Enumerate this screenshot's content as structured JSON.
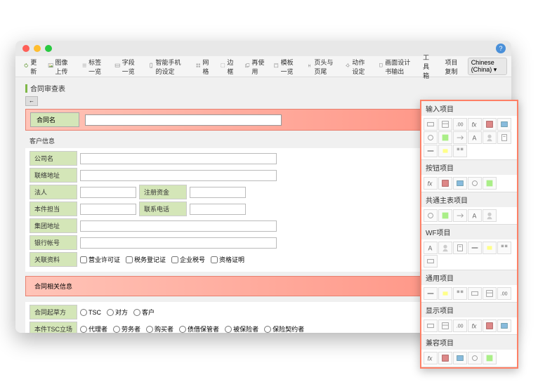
{
  "toolbar": {
    "refresh": "更新",
    "imageUpload": "图像上传",
    "labelList": "标签一览",
    "fieldList": "字段一览",
    "smartphoneSettings": "智能手机的设定",
    "grid": "网格",
    "border": "边框",
    "reuse": "再使用",
    "templateList": "模板一览",
    "headerFooter": "页头与页尾",
    "actionSettings": "动作设定",
    "designOutput": "画面设计书输出",
    "toolbox": "工具箱",
    "itemCopy": "项目复制",
    "language": "Chinese (China)"
  },
  "page": {
    "title": "合同审查表",
    "back": "←"
  },
  "highlight1": {
    "label": "合同名",
    "arrow": "◀◀"
  },
  "customerSection": "客户信息",
  "form": {
    "companyName": "公司名",
    "contactAddress": "联络地址",
    "legalPerson": "法人",
    "registeredCapital": "注册资金",
    "caseOwner": "本件担当",
    "contactPhone": "联系电话",
    "groupAddress": "集团地址",
    "bankAccount": "银行帐号",
    "relatedDocs": "关联资料",
    "relatedDocsOptions": [
      "营业许可证",
      "税务登记证",
      "企业税号",
      "资格证明"
    ]
  },
  "highlight2": {
    "label": "合同相关信息",
    "arrow": "◀◀"
  },
  "form2": {
    "draftParty": "合同起草方",
    "draftOptions": [
      "TSC",
      "对方",
      "客户"
    ],
    "tscPosition": "本件TSC立场",
    "positionOptions": [
      "代理者",
      "劳务者",
      "购买者",
      "债借保管者",
      "被保险者",
      "保险契约者"
    ]
  },
  "palette": {
    "sections": [
      {
        "title": "输入项目",
        "count": 15
      },
      {
        "title": "按钮项目",
        "count": 5
      },
      {
        "title": "共通主表项目",
        "count": 5
      },
      {
        "title": "WF项目",
        "count": 7
      },
      {
        "title": "通用项目",
        "count": 6
      },
      {
        "title": "显示项目",
        "count": 6
      },
      {
        "title": "兼容项目",
        "count": 5
      }
    ]
  }
}
